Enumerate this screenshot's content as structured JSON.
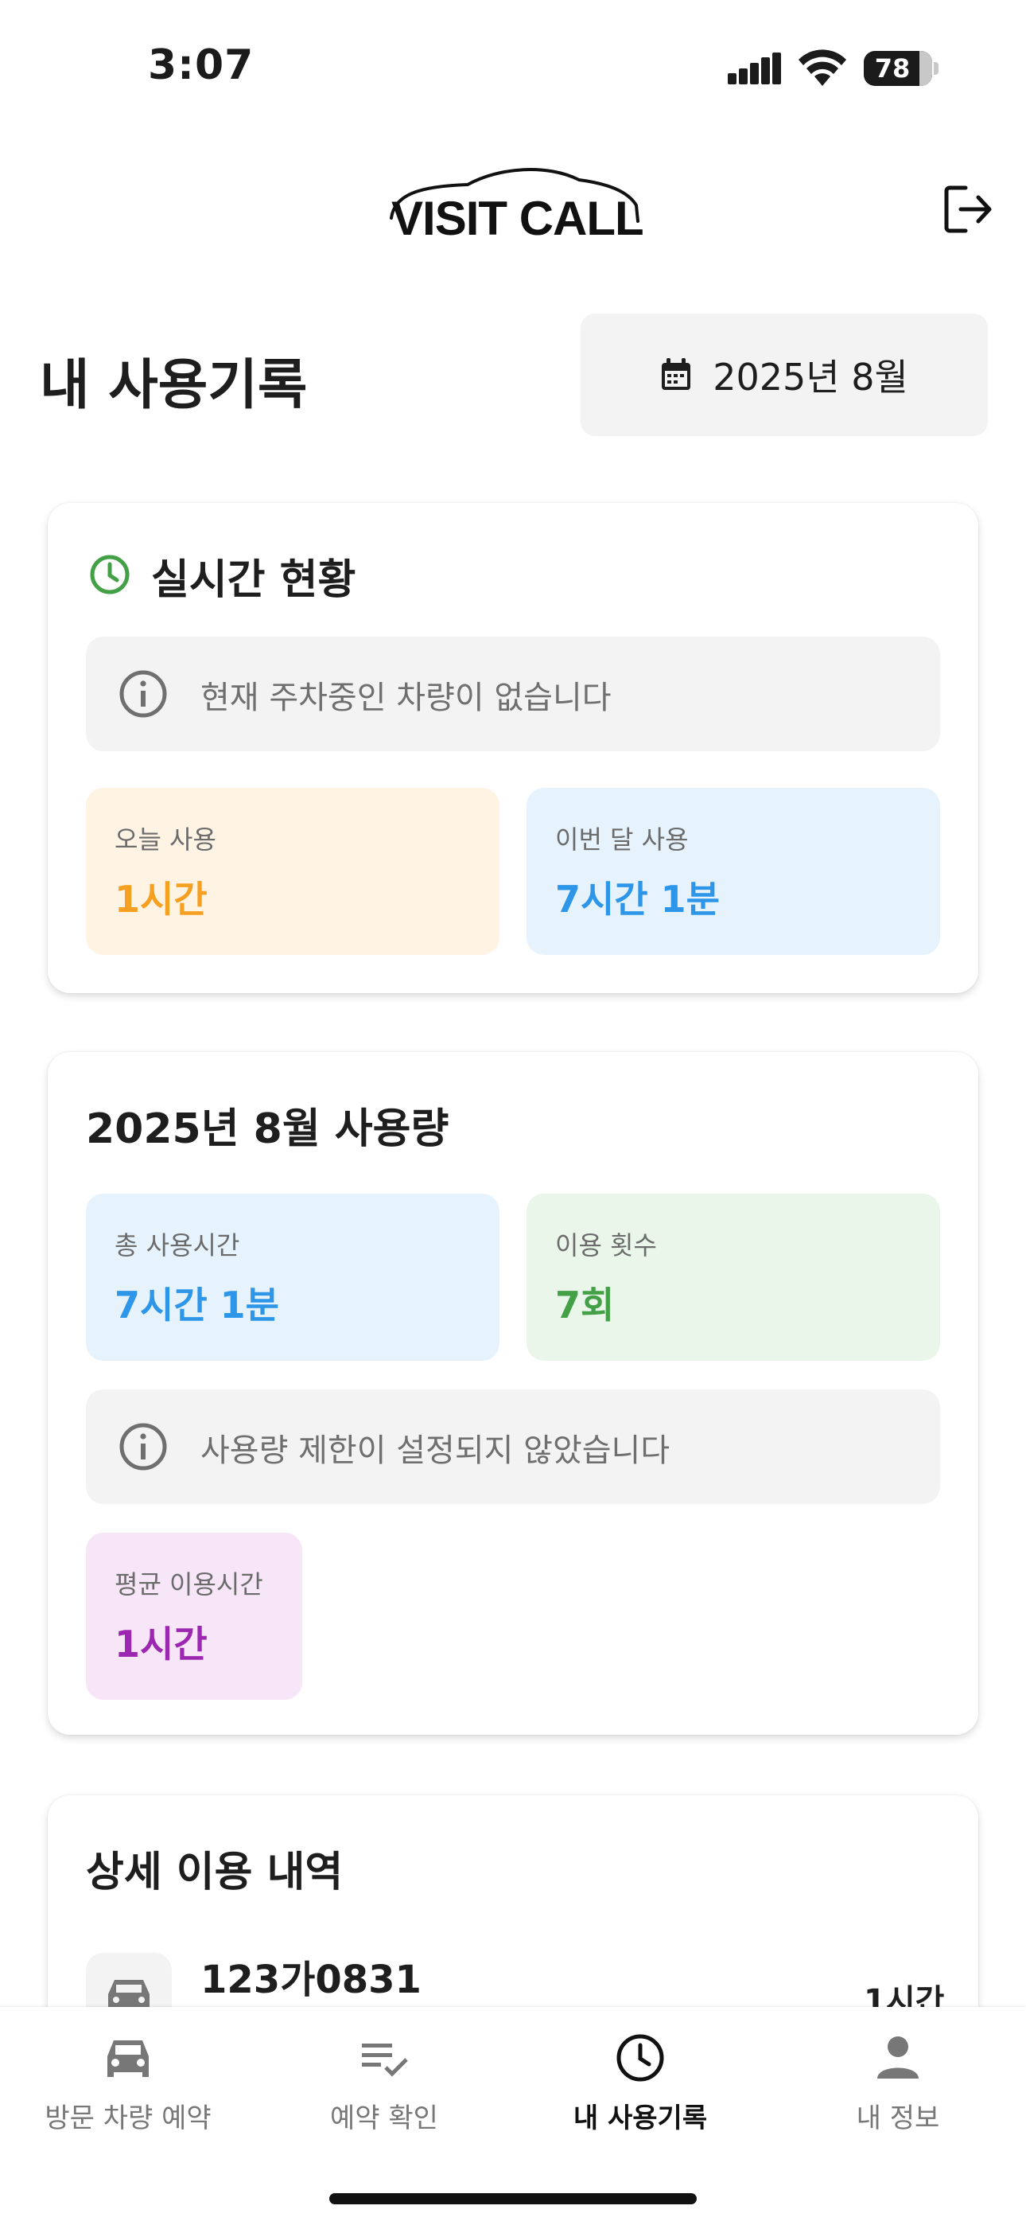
{
  "status_bar": {
    "time": "3:07",
    "battery": "78"
  },
  "header": {
    "logo_text": "VISIT CALL"
  },
  "page": {
    "title": "내 사용기록",
    "month_selector": "2025년 8월"
  },
  "realtime": {
    "title": "실시간 현황",
    "notice": "현재 주차중인 차량이 없습니다",
    "today_label": "오늘 사용",
    "today_value": "1시간",
    "month_label": "이번 달 사용",
    "month_value": "7시간 1분"
  },
  "usage": {
    "title": "2025년 8월 사용량",
    "total_label": "총 사용시간",
    "total_value": "7시간 1분",
    "count_label": "이용 횟수",
    "count_value": "7회",
    "notice": "사용량 제한이 설정되지 않았습니다",
    "avg_label": "평균 이용시간",
    "avg_value": "1시간"
  },
  "detail": {
    "title": "상세 이용 내역",
    "rows": [
      {
        "plate": "123가0831",
        "duration": "1시간"
      }
    ]
  },
  "nav": [
    {
      "label": "방문 차량 예약",
      "icon": "car-icon"
    },
    {
      "label": "예약 확인",
      "icon": "checklist-icon"
    },
    {
      "label": "내 사용기록",
      "icon": "clock-icon",
      "active": true
    },
    {
      "label": "내 정보",
      "icon": "person-icon"
    }
  ],
  "colors": {
    "orange": "#F5A020",
    "blue": "#2E96E8",
    "green": "#43A047",
    "purple": "#9C27B0",
    "orange_bg": "#FFF3E4",
    "blue_bg": "#E6F3FD",
    "green_bg": "#EAF6EA",
    "purple_bg": "#F6E6F7"
  }
}
